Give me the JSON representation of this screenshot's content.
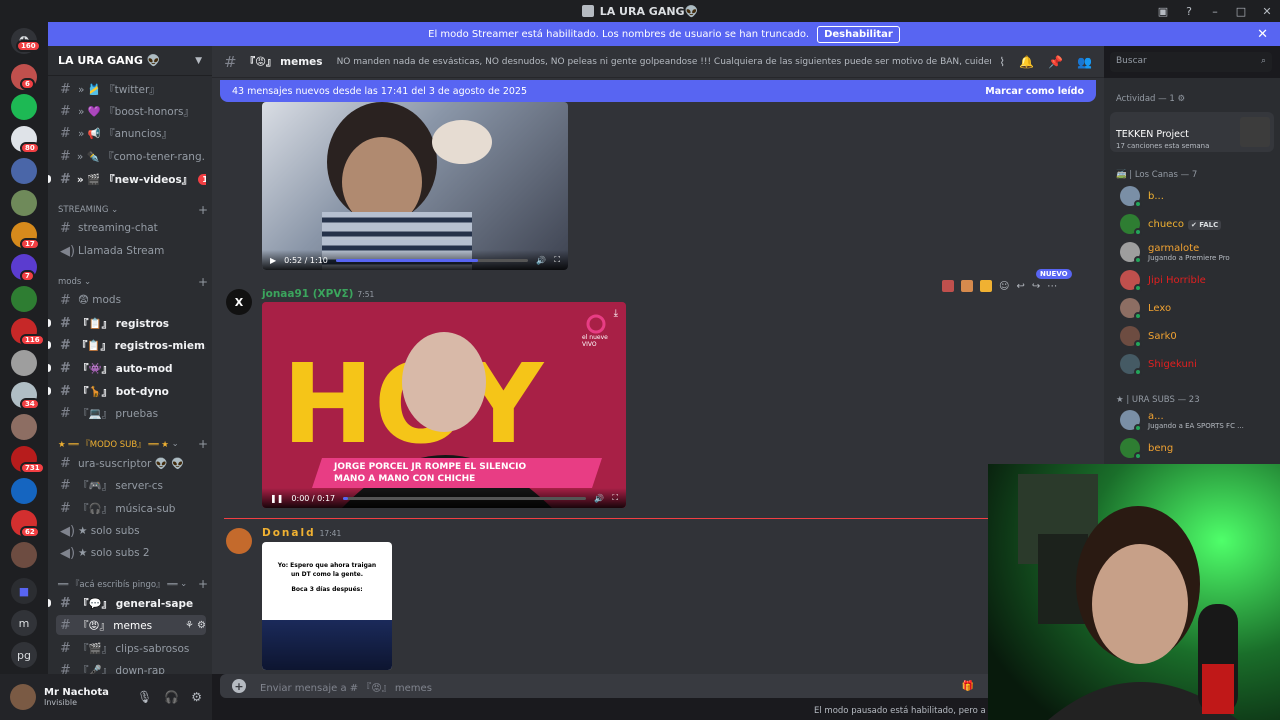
{
  "window": {
    "title": "LA URA GANG👽",
    "controls": [
      "–",
      "□",
      "✕"
    ]
  },
  "banner": {
    "text": "El modo Streamer está habilitado. Los nombres de usuario se han truncado.",
    "button": "Deshabilitar"
  },
  "servers": {
    "top_badge": "160",
    "badges": [
      "6",
      "80",
      "17",
      "7",
      "116",
      "34",
      "731",
      "62"
    ],
    "letters": [
      "m",
      "pg"
    ]
  },
  "guild": {
    "name": "LA URA GANG 👽"
  },
  "channels": {
    "twitter": "» 🎽 『twitter』",
    "boost": "» 💜 『boost-honors』",
    "anuncios": "» 📢 『anuncios』",
    "rang": "» ✒️ 『como-tener-rang...",
    "newvideos": "» 🎬 『new-videos』",
    "newvideos_badge": "14",
    "cat_streaming": "STREAMING",
    "streaming_chat": "streaming-chat",
    "llamada": "Llamada Stream",
    "cat_mods": "mods",
    "mods": "😨 mods",
    "registros": "『📋』 registros",
    "registros_miem": "『📋』 registros-miem...",
    "automod": "『👾』 auto-mod",
    "botdyno": "『🦒』 bot-dyno",
    "pruebas": "『💻』 pruebas",
    "cat_sub": "★ ══ 『MODO SUB』 ══ ★",
    "urasub": "ura-suscriptor 👽 👽",
    "servercs": "『🎮』 server-cs",
    "musica": "『🎧』 música-sub",
    "solosubs": "★ solo subs",
    "solosubs2": "★ solo subs 2",
    "cat_pingo": "══ 『acá escribís pingo』 ══",
    "generalsape": "『💬』 general-sape",
    "memes": "『😡』 memes",
    "clips": "『🎬』 clips-sabrosos",
    "downrap": "『🎤』 down-rap"
  },
  "user": {
    "name": "Mr Nachota",
    "status": "Invisible"
  },
  "header": {
    "channel": "『😡』 memes",
    "topic": "NO manden nada de esvásticas, NO desnudos, NO peleas ni gente golpeandose !!! Cualquiera de las siguientes puede ser motivo de BAN, cuiden el stream!",
    "search_placeholder": "Buscar"
  },
  "newbar": {
    "text": "43 mensajes nuevos desde las 17:41 del 3 de agosto de 2025",
    "mark": "Marcar como leído"
  },
  "messages": [
    {
      "video_time": "0:52 / 1:10",
      "progress": 0.74
    },
    {
      "author": "jonaa91 (XPVΣ)",
      "time": "7:51",
      "video_time": "0:00 / 0:17",
      "progress": 0.02,
      "caption_line1": "JORGE PORCEL JR ROMPE EL SILENCIO",
      "caption_line2": "MANO A MANO CON CHICHE",
      "channel_logo": "el nueve\nVIVO",
      "bg_text": "HOY"
    },
    {
      "author": "Donald",
      "time": "17:41",
      "meme_line1": "Yo: Espero que ahora traigan",
      "meme_line2": "un DT como la gente.",
      "meme_line3": "Boca 3 días después:"
    }
  ],
  "hover_badge": "NUEVO",
  "composer": {
    "placeholder": "Enviar mensaje a # 『😡』 memes"
  },
  "paused_notice": "El modo pausado está habilitado, pero a ti n",
  "members": {
    "activity_label": "Actividad — 1",
    "activity_title": "TEKKEN Project",
    "activity_sub": "17 canciones esta semana",
    "cat1": "🚎 | Los Canas — 7",
    "cat2": "★ | URA SUBS — 23",
    "list1": [
      {
        "name": "b...",
        "color": "#f0b132"
      },
      {
        "name": "chueco",
        "color": "#f0b132",
        "tag": "✔ FALC"
      },
      {
        "name": "garmalote",
        "color": "#f0a232",
        "sub": "Jugando a Premiere Pro"
      },
      {
        "name": "Jipi Horrible",
        "color": "#e02020"
      },
      {
        "name": "Lexo",
        "color": "#f0a232"
      },
      {
        "name": "Sark0",
        "color": "#f0a232"
      },
      {
        "name": "Shigekuni",
        "color": "#e02020"
      }
    ],
    "list2": [
      {
        "name": "a...",
        "color": "#f0a232",
        "sub": "Jugando a EA SPORTS FC ..."
      },
      {
        "name": "beng",
        "color": "#f0a232"
      }
    ]
  }
}
